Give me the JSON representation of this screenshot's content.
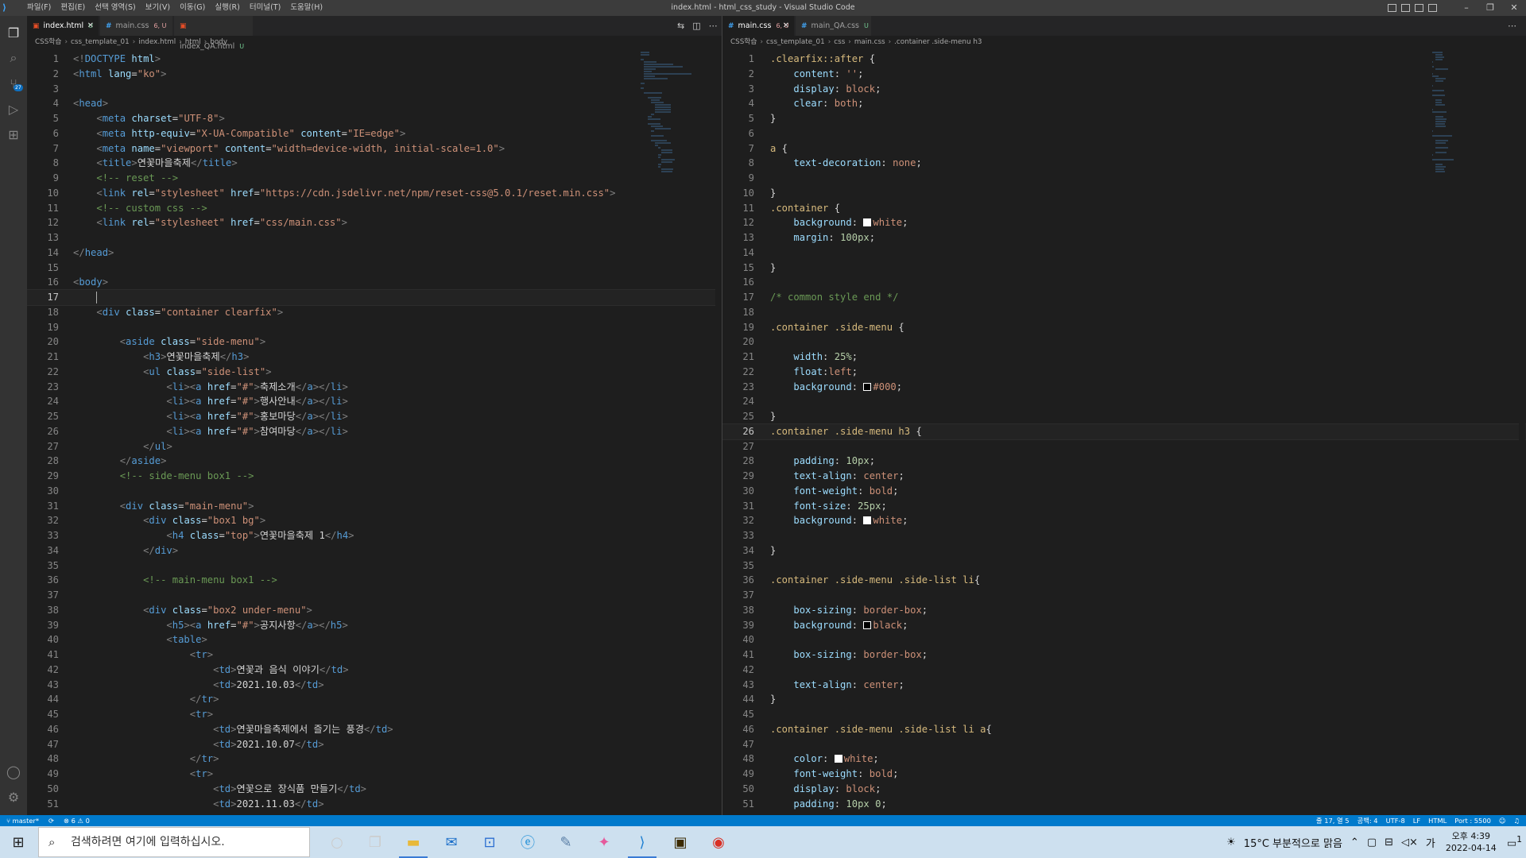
{
  "window": {
    "menus": [
      "파일(F)",
      "편집(E)",
      "선택 영역(S)",
      "보기(V)",
      "이동(G)",
      "실행(R)",
      "터미널(T)",
      "도움말(H)"
    ],
    "title": "index.html - html_css_study - Visual Studio Code"
  },
  "left_editor": {
    "tabs": [
      {
        "name": "index.html",
        "status": "U",
        "active": true
      },
      {
        "name": "main.css",
        "status": "6, U",
        "active": false
      },
      {
        "name": "index_QA.html",
        "status": "U",
        "active": false
      }
    ],
    "breadcrumb": [
      "CSS학습",
      "css_template_01",
      "index.html",
      "html",
      "body"
    ]
  },
  "right_editor": {
    "tabs": [
      {
        "name": "main.css",
        "status": "6, U",
        "active": true
      },
      {
        "name": "main_QA.css",
        "status": "U",
        "active": false
      }
    ],
    "breadcrumb": [
      "CSS학습",
      "css_template_01",
      "css",
      "main.css",
      ".container .side-menu h3"
    ]
  },
  "html_lines": [
    "<!DOCTYPE html>",
    "<html lang=\"ko\">",
    "",
    "<head>",
    "    <meta charset=\"UTF-8\">",
    "    <meta http-equiv=\"X-UA-Compatible\" content=\"IE=edge\">",
    "    <meta name=\"viewport\" content=\"width=device-width, initial-scale=1.0\">",
    "    <title>연꽃마을축제</title>",
    "    <!-- reset -->",
    "    <link rel=\"stylesheet\" href=\"https://cdn.jsdelivr.net/npm/reset-css@5.0.1/reset.min.css\">",
    "    <!-- custom css -->",
    "    <link rel=\"stylesheet\" href=\"css/main.css\">",
    "",
    "</head>",
    "",
    "<body>",
    "    ",
    "    <div class=\"container clearfix\">",
    "",
    "        <aside class=\"side-menu\">",
    "            <h3>연꽃마을축제</h3>",
    "            <ul class=\"side-list\">",
    "                <li><a href=\"#\">축제소개</a></li>",
    "                <li><a href=\"#\">행사안내</a></li>",
    "                <li><a href=\"#\">홍보마당</a></li>",
    "                <li><a href=\"#\">참여마당</a></li>",
    "            </ul>",
    "        </aside>",
    "        <!-- side-menu box1 -->",
    "",
    "        <div class=\"main-menu\">",
    "            <div class=\"box1 bg\">",
    "                <h4 class=\"top\">연꽃마을축제 1</h4>",
    "            </div>",
    "",
    "            <!-- main-menu box1 -->",
    "",
    "            <div class=\"box2 under-menu\">",
    "                <h5><a href=\"#\">공지사항</a></h5>",
    "                <table>",
    "                    <tr>",
    "                        <td>연꽃과 음식 이야기</td>",
    "                        <td>2021.10.03</td>",
    "                    </tr>",
    "                    <tr>",
    "                        <td>연꽃마을축제에서 즐기는 풍경</td>",
    "                        <td>2021.10.07</td>",
    "                    </tr>",
    "                    <tr>",
    "                        <td>연꽃으로 장식품 만들기</td>",
    "                        <td>2021.11.03</td>"
  ],
  "css_lines": [
    ".clearfix::after {",
    "    content: '';",
    "    display: block;",
    "    clear: both;",
    "}",
    "",
    "a {",
    "    text-decoration: none;",
    "",
    "}",
    ".container {",
    "    background: white;",
    "    margin: 100px;",
    "",
    "}",
    "",
    "/* common style end */",
    "",
    ".container .side-menu {",
    "",
    "    width: 25%;",
    "    float:left;",
    "    background: #000;",
    "",
    "}",
    ".container .side-menu h3 {",
    "",
    "    padding: 10px;",
    "    text-align: center;",
    "    font-weight: bold;",
    "    font-size: 25px;",
    "    background: white;",
    "",
    "}",
    "",
    ".container .side-menu .side-list li{",
    "",
    "    box-sizing: border-box;",
    "    background: black;",
    "",
    "    box-sizing: border-box;",
    "",
    "    text-align: center;",
    "}",
    "",
    ".container .side-menu .side-list li a{",
    "",
    "    color: white;",
    "    font-weight: bold;",
    "    display: block;",
    "    padding: 10px 0;"
  ],
  "statusbar": {
    "branch": "master*",
    "problems": "⊗ 6 ⚠ 0",
    "position": "줄 17, 열 5",
    "spaces": "공백: 4",
    "encoding": "UTF-8",
    "eol": "LF",
    "language": "HTML",
    "port": "Port : 5500"
  },
  "taskbar": {
    "search_placeholder": "검색하려면 여기에 입력하십시오.",
    "weather": "15°C  부분적으로 맑음",
    "ime": "가",
    "time": "오후 4:39",
    "date": "2022-04-14",
    "notifications": "1"
  },
  "colors": {
    "accent": "#007acc",
    "tag": "#569cd6",
    "attr": "#9cdcfe",
    "string": "#ce9178",
    "comment": "#6a9955",
    "selector": "#d7ba7d",
    "number": "#b5cea8"
  }
}
